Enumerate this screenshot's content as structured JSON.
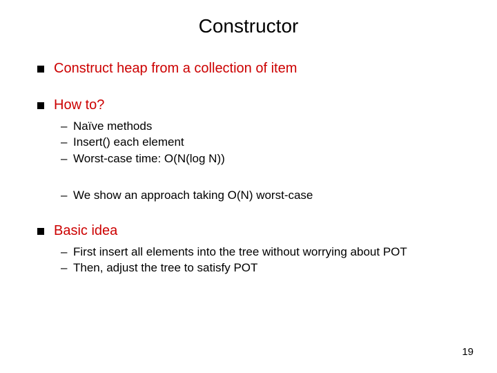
{
  "title": "Constructor",
  "bullets": [
    {
      "text": "Construct heap from a collection of item",
      "sub": []
    },
    {
      "text": "How to?",
      "sub": [
        "Naïve methods",
        "Insert() each element",
        "Worst-case time: O(N(log N))",
        "__GAP__",
        "We show an approach taking O(N) worst-case"
      ]
    },
    {
      "text": "Basic idea",
      "sub": [
        "First insert all elements into the tree without worrying about POT",
        "Then, adjust the tree to satisfy POT"
      ]
    }
  ],
  "page_number": "19"
}
